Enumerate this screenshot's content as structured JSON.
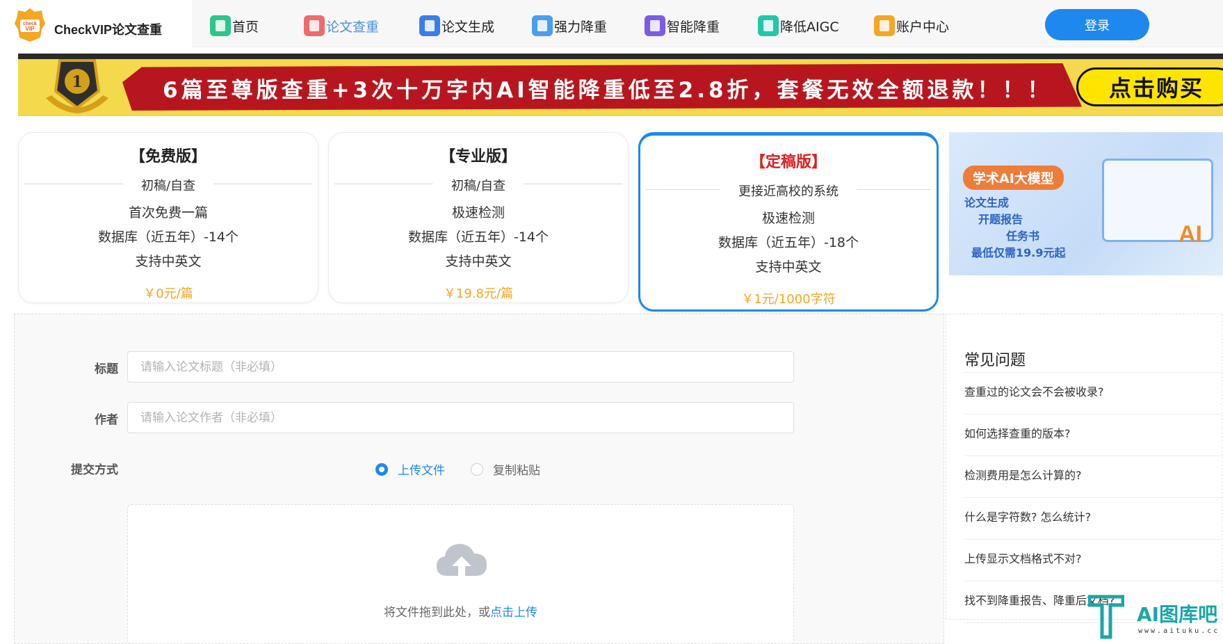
{
  "brand": {
    "name": "CheckVIP论文查重",
    "badge_text": "check VIP"
  },
  "nav": [
    {
      "label": "首页",
      "color": "#2ec58a",
      "active": false
    },
    {
      "label": "论文查重",
      "color": "#f06a6a",
      "active": true
    },
    {
      "label": "论文生成",
      "color": "#3b7ee8",
      "active": false
    },
    {
      "label": "强力降重",
      "color": "#4a9ef0",
      "active": false
    },
    {
      "label": "智能降重",
      "color": "#7a5ce8",
      "active": false
    },
    {
      "label": "降低AIGC",
      "color": "#22c7a8",
      "active": false
    },
    {
      "label": "账户中心",
      "color": "#f5a623",
      "active": false
    }
  ],
  "login_label": "登录",
  "banner": {
    "text": "6篇至尊版查重+3次十万字内AI智能降重低至2.8折，套餐无效全额退款！！！",
    "cta": "点击购买"
  },
  "plans": [
    {
      "title": "【免费版】",
      "subtitle": "初稿/自查",
      "features": [
        "首次免费一篇",
        "数据库（近五年）-14个",
        "支持中英文"
      ],
      "price": "￥0元/篇",
      "selected": false
    },
    {
      "title": "【专业版】",
      "subtitle": "初稿/自查",
      "features": [
        "极速检测",
        "数据库（近五年）-14个",
        "支持中英文"
      ],
      "price": "￥19.8元/篇",
      "selected": false
    },
    {
      "title": "【定稿版】",
      "subtitle": "更接近高校的系统",
      "features": [
        "极速检测",
        "数据库（近五年）-18个",
        "支持中英文"
      ],
      "price": "￥1元/1000字符",
      "selected": true
    }
  ],
  "promo": {
    "tag": "学术AI大模型",
    "lines": [
      "论文生成",
      "开题报告",
      "任务书",
      "最低仅需19.9元起"
    ],
    "ai": "AI"
  },
  "form": {
    "title_label": "标题",
    "title_placeholder": "请输入论文标题（非必填）",
    "author_label": "作者",
    "author_placeholder": "请输入论文作者（非必填）",
    "method_label": "提交方式",
    "method_options": [
      {
        "label": "上传文件",
        "checked": true
      },
      {
        "label": "复制粘贴",
        "checked": false
      }
    ],
    "upload_hint": "将文件拖到此处，或",
    "upload_link": "点击上传"
  },
  "faq": {
    "title": "常见问题",
    "items": [
      "查重过的论文会不会被收录?",
      "如何选择查重的版本?",
      "检测费用是怎么计算的?",
      "什么是字符数? 怎么统计?",
      "上传显示文档格式不对?",
      "找不到降重报告、降重后文档?"
    ]
  },
  "watermark": {
    "text": "AI图库吧",
    "sub": "www.aituku.cc"
  }
}
